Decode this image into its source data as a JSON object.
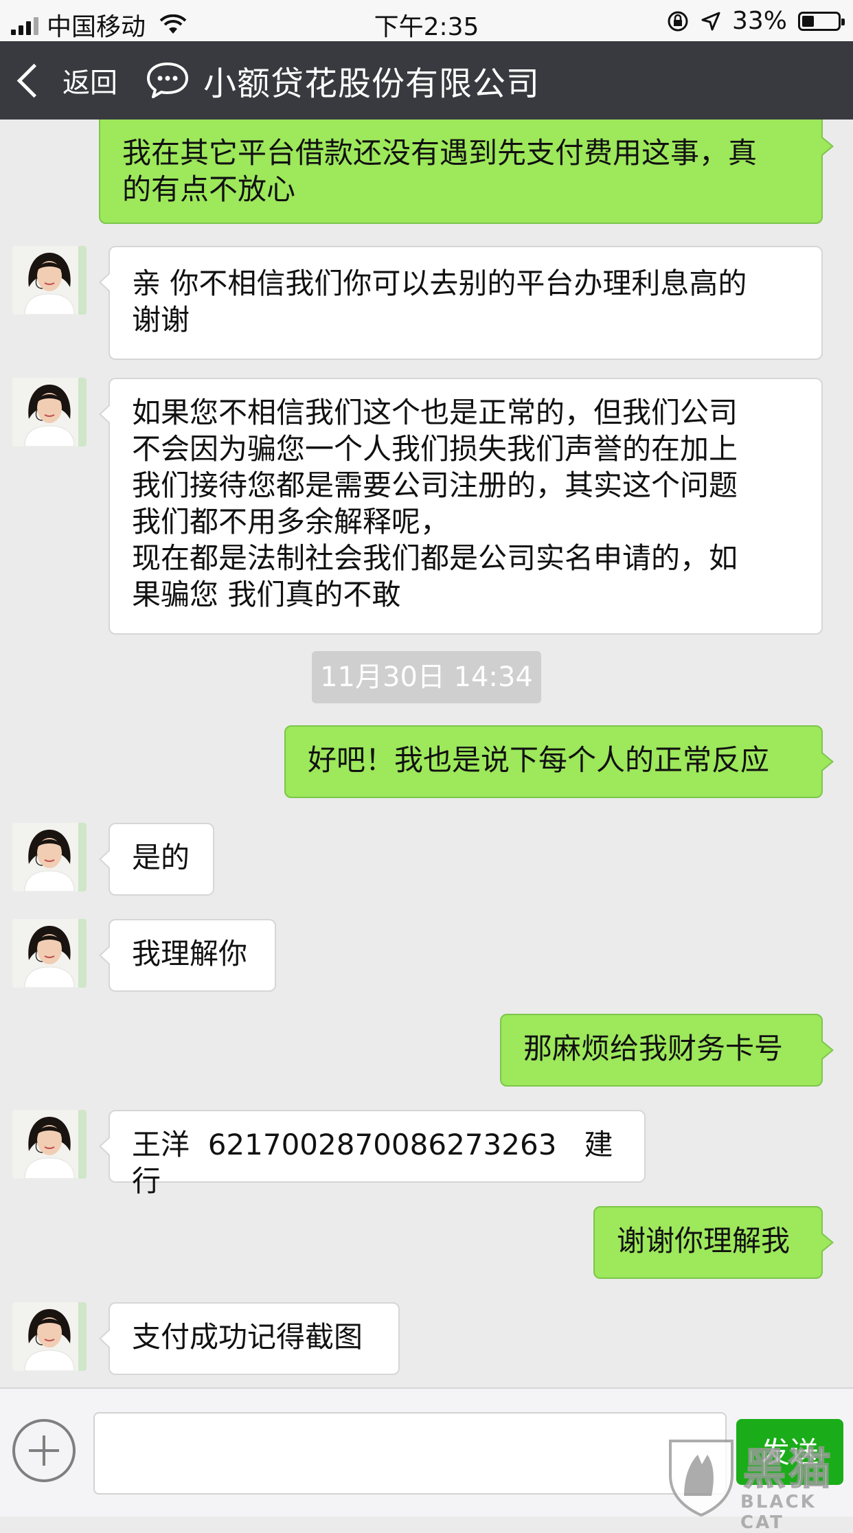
{
  "status_bar": {
    "carrier": "中国移动",
    "time": "下午2:35",
    "battery": "33%",
    "battery_level": 0.33
  },
  "nav": {
    "back_label": "返回",
    "title": "小额贷花股份有限公司"
  },
  "messages": [
    {
      "from": "me",
      "text": "我在其它平台借款还没有遇到先支付费用这事，真\n的有点不放心"
    },
    {
      "from": "them",
      "text": "亲 你不相信我们你可以去别的平台办理利息高的\n谢谢"
    },
    {
      "from": "them",
      "text": "如果您不相信我们这个也是正常的，但我们公司\n不会因为骗您一个人我们损失我们声誉的在加上\n我们接待您都是需要公司注册的，其实这个问题\n我们都不用多余解释呢，\n现在都是法制社会我们都是公司实名申请的，如\n果骗您 我们真的不敢"
    },
    {
      "from": "me",
      "text": "好吧！我也是说下每个人的正常反应"
    },
    {
      "from": "them",
      "text": "是的"
    },
    {
      "from": "them",
      "text": "我理解你"
    },
    {
      "from": "me",
      "text": "那麻烦给我财务卡号"
    },
    {
      "from": "them",
      "text": "王洋  6217002870086273263   建行"
    },
    {
      "from": "me",
      "text": "谢谢你理解我"
    },
    {
      "from": "them",
      "text": "支付成功记得截图"
    }
  ],
  "timestamp": "11月30日 14:34",
  "input_bar": {
    "placeholder": "",
    "send_label": "发送"
  },
  "watermark": {
    "cn": "黑猫",
    "en": "BLACK CAT"
  },
  "colors": {
    "outgoing_bubble": "#9de85b",
    "incoming_bubble": "#ffffff",
    "nav_background": "#393a3f",
    "send_button": "#1aad19",
    "chat_background": "#ebebeb"
  },
  "icons": {
    "signal": "signal-bars-icon",
    "wifi": "wifi-icon",
    "lock": "rotation-lock-icon",
    "location": "location-arrow-icon",
    "battery": "battery-icon",
    "back": "chevron-left-icon",
    "chat": "chat-bubble-icon",
    "plus": "plus-circle-icon"
  }
}
